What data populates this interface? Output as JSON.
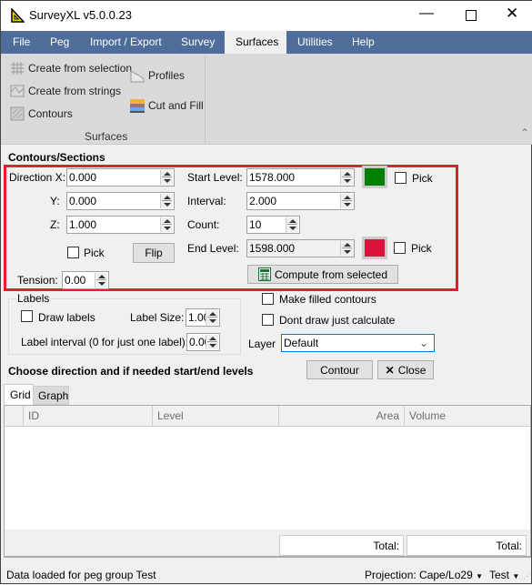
{
  "window": {
    "title": "SurveyXL v5.0.0.23"
  },
  "menu": [
    "File",
    "Peg",
    "Import / Export",
    "Survey",
    "Surfaces",
    "Utilities",
    "Help"
  ],
  "ribbon": {
    "items": [
      {
        "label": "Create from selection",
        "icon": "grid-icon"
      },
      {
        "label": "Create from strings",
        "icon": "strings-icon"
      },
      {
        "label": "Contours",
        "icon": "contours-icon"
      },
      {
        "label": "Profiles",
        "icon": "profiles-icon"
      },
      {
        "label": "Cut and Fill",
        "icon": "cut-fill-icon"
      }
    ],
    "group_label": "Surfaces"
  },
  "section_title": "Contours/Sections",
  "direction": {
    "x_label": "Direction X:",
    "x": "0.000",
    "y_label": "Y:",
    "y": "0.000",
    "z_label": "Z:",
    "z": "1.000",
    "pick_label": "Pick",
    "flip_label": "Flip"
  },
  "tension": {
    "label": "Tension:",
    "value": "0.00"
  },
  "levels": {
    "start_label": "Start Level:",
    "start": "1578.000",
    "start_color": "#008000",
    "interval_label": "Interval:",
    "interval": "2.000",
    "count_label": "Count:",
    "count": "10",
    "end_label": "End Level:",
    "end": "1598.000",
    "end_color": "#dc143c",
    "pick_label": "Pick",
    "compute_label": "Compute from selected"
  },
  "labels": {
    "group": "Labels",
    "draw_labels": "Draw labels",
    "size_label": "Label Size:",
    "size": "1.00",
    "interval_label": "Label interval (0 for just one label):",
    "interval": "0.00"
  },
  "options": {
    "filled": "Make filled contours",
    "dont_draw": "Dont draw just calculate"
  },
  "layer": {
    "label": "Layer",
    "value": "Default"
  },
  "hint": "Choose direction and if needed start/end levels",
  "buttons": {
    "contour": "Contour",
    "close": "Close"
  },
  "tabs": [
    "Grid",
    "Graph"
  ],
  "grid": {
    "columns": [
      "ID",
      "Level",
      "Area",
      "Volume"
    ],
    "rows": [],
    "total1": "Total:",
    "total2": "Total:"
  },
  "status": {
    "message": "Data loaded for peg group Test",
    "projection": "Projection: Cape/Lo29",
    "group": "Test"
  }
}
